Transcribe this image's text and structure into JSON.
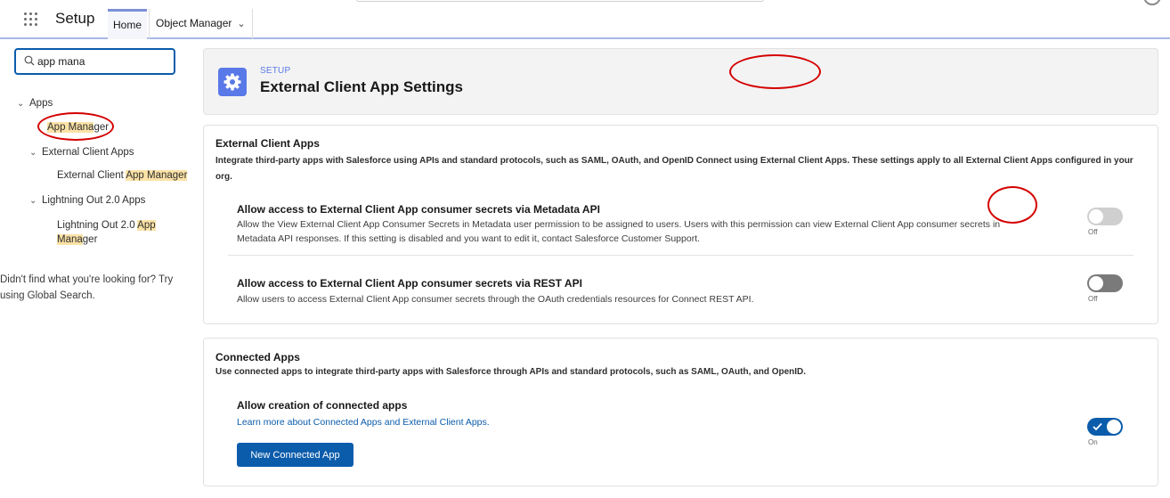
{
  "topbar": {
    "app_name": "Setup",
    "tabs": [
      {
        "label": "Home"
      },
      {
        "label": "Object Manager"
      }
    ]
  },
  "sidebar": {
    "search_value": "app mana",
    "tree": {
      "apps_label": "Apps",
      "app_manager": {
        "highlight": "App Mana",
        "rest": "ger"
      },
      "external_client_apps_label": "External Client Apps",
      "ext_app_manager": {
        "prefix": "External Client ",
        "highlight": "App Manager"
      },
      "lightning_out_label": "Lightning Out 2.0 Apps",
      "lo_app_manager": {
        "prefix": "Lightning Out 2.0 ",
        "highlight1": "App",
        "highlight2": "Mana",
        "rest": "ger"
      }
    },
    "help_text": "Didn't find what you're looking for? Try using Global Search."
  },
  "header": {
    "eyebrow": "SETUP",
    "title": "External Client App Settings"
  },
  "external_client_apps": {
    "title": "External Client Apps",
    "description": "Integrate third-party apps with Salesforce using APIs and standard protocols, such as SAML, OAuth, and OpenID Connect using External Client Apps. These settings apply to all External Client Apps configured in your org.",
    "settings": [
      {
        "title": "Allow access to External Client App consumer secrets via Metadata API",
        "description": "Allow the View External Client App Consumer Secrets in Metadata user permission to be assigned to users. Users with this permission can view External Client App consumer secrets in Metadata API responses. If this setting is disabled and you want to edit it, contact Salesforce Customer Support.",
        "state": "Off",
        "enabled": false
      },
      {
        "title": "Allow access to External Client App consumer secrets via REST API",
        "description": "Allow users to access External Client App consumer secrets through the OAuth credentials resources for Connect REST API.",
        "state": "Off",
        "enabled": true
      }
    ]
  },
  "connected_apps": {
    "title": "Connected Apps",
    "description": "Use connected apps to integrate third-party apps with Salesforce through APIs and standard protocols, such as SAML, OAuth, and OpenID.",
    "setting_title": "Allow creation of connected apps",
    "link_text": "Learn more about Connected Apps and External Client Apps.",
    "state": "On",
    "button_label": "New Connected App"
  },
  "colors": {
    "brand": "#0b5cab",
    "header_icon": "#5a79e8",
    "annotation": "#d40000",
    "highlight": "#fbe2a6"
  },
  "icons": [
    "app-launcher-icon",
    "chevron-down-icon",
    "search-icon",
    "gear-icon",
    "check-icon"
  ]
}
